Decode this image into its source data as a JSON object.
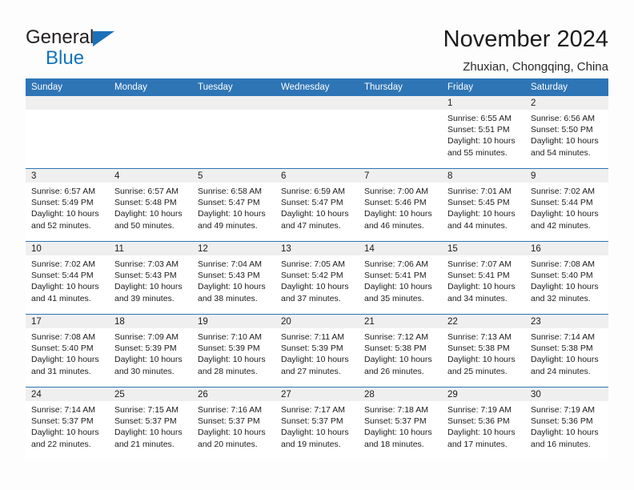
{
  "brand": {
    "name_part1": "General",
    "name_part2": "Blue",
    "logo_icon": "blue-triangle-icon",
    "accent_color": "#1573bb"
  },
  "header": {
    "month_title": "November 2024",
    "location": "Zhuxian, Chongqing, China"
  },
  "theme": {
    "header_blue": "#2e75b6",
    "daynum_band_gray": "#efefef",
    "cell_white": "#ffffff",
    "text_dark": "#1c1c1c"
  },
  "calendar": {
    "weekday_headers": [
      "Sunday",
      "Monday",
      "Tuesday",
      "Wednesday",
      "Thursday",
      "Friday",
      "Saturday"
    ],
    "weeks": [
      [
        {
          "day": "",
          "empty": true,
          "sunrise": "",
          "sunset": "",
          "daylight_line1": "",
          "daylight_line2": ""
        },
        {
          "day": "",
          "empty": true,
          "sunrise": "",
          "sunset": "",
          "daylight_line1": "",
          "daylight_line2": ""
        },
        {
          "day": "",
          "empty": true,
          "sunrise": "",
          "sunset": "",
          "daylight_line1": "",
          "daylight_line2": ""
        },
        {
          "day": "",
          "empty": true,
          "sunrise": "",
          "sunset": "",
          "daylight_line1": "",
          "daylight_line2": ""
        },
        {
          "day": "",
          "empty": true,
          "sunrise": "",
          "sunset": "",
          "daylight_line1": "",
          "daylight_line2": ""
        },
        {
          "day": "1",
          "empty": false,
          "sunrise": "Sunrise: 6:55 AM",
          "sunset": "Sunset: 5:51 PM",
          "daylight_line1": "Daylight: 10 hours",
          "daylight_line2": "and 55 minutes."
        },
        {
          "day": "2",
          "empty": false,
          "sunrise": "Sunrise: 6:56 AM",
          "sunset": "Sunset: 5:50 PM",
          "daylight_line1": "Daylight: 10 hours",
          "daylight_line2": "and 54 minutes."
        }
      ],
      [
        {
          "day": "3",
          "empty": false,
          "sunrise": "Sunrise: 6:57 AM",
          "sunset": "Sunset: 5:49 PM",
          "daylight_line1": "Daylight: 10 hours",
          "daylight_line2": "and 52 minutes."
        },
        {
          "day": "4",
          "empty": false,
          "sunrise": "Sunrise: 6:57 AM",
          "sunset": "Sunset: 5:48 PM",
          "daylight_line1": "Daylight: 10 hours",
          "daylight_line2": "and 50 minutes."
        },
        {
          "day": "5",
          "empty": false,
          "sunrise": "Sunrise: 6:58 AM",
          "sunset": "Sunset: 5:47 PM",
          "daylight_line1": "Daylight: 10 hours",
          "daylight_line2": "and 49 minutes."
        },
        {
          "day": "6",
          "empty": false,
          "sunrise": "Sunrise: 6:59 AM",
          "sunset": "Sunset: 5:47 PM",
          "daylight_line1": "Daylight: 10 hours",
          "daylight_line2": "and 47 minutes."
        },
        {
          "day": "7",
          "empty": false,
          "sunrise": "Sunrise: 7:00 AM",
          "sunset": "Sunset: 5:46 PM",
          "daylight_line1": "Daylight: 10 hours",
          "daylight_line2": "and 46 minutes."
        },
        {
          "day": "8",
          "empty": false,
          "sunrise": "Sunrise: 7:01 AM",
          "sunset": "Sunset: 5:45 PM",
          "daylight_line1": "Daylight: 10 hours",
          "daylight_line2": "and 44 minutes."
        },
        {
          "day": "9",
          "empty": false,
          "sunrise": "Sunrise: 7:02 AM",
          "sunset": "Sunset: 5:44 PM",
          "daylight_line1": "Daylight: 10 hours",
          "daylight_line2": "and 42 minutes."
        }
      ],
      [
        {
          "day": "10",
          "empty": false,
          "sunrise": "Sunrise: 7:02 AM",
          "sunset": "Sunset: 5:44 PM",
          "daylight_line1": "Daylight: 10 hours",
          "daylight_line2": "and 41 minutes."
        },
        {
          "day": "11",
          "empty": false,
          "sunrise": "Sunrise: 7:03 AM",
          "sunset": "Sunset: 5:43 PM",
          "daylight_line1": "Daylight: 10 hours",
          "daylight_line2": "and 39 minutes."
        },
        {
          "day": "12",
          "empty": false,
          "sunrise": "Sunrise: 7:04 AM",
          "sunset": "Sunset: 5:43 PM",
          "daylight_line1": "Daylight: 10 hours",
          "daylight_line2": "and 38 minutes."
        },
        {
          "day": "13",
          "empty": false,
          "sunrise": "Sunrise: 7:05 AM",
          "sunset": "Sunset: 5:42 PM",
          "daylight_line1": "Daylight: 10 hours",
          "daylight_line2": "and 37 minutes."
        },
        {
          "day": "14",
          "empty": false,
          "sunrise": "Sunrise: 7:06 AM",
          "sunset": "Sunset: 5:41 PM",
          "daylight_line1": "Daylight: 10 hours",
          "daylight_line2": "and 35 minutes."
        },
        {
          "day": "15",
          "empty": false,
          "sunrise": "Sunrise: 7:07 AM",
          "sunset": "Sunset: 5:41 PM",
          "daylight_line1": "Daylight: 10 hours",
          "daylight_line2": "and 34 minutes."
        },
        {
          "day": "16",
          "empty": false,
          "sunrise": "Sunrise: 7:08 AM",
          "sunset": "Sunset: 5:40 PM",
          "daylight_line1": "Daylight: 10 hours",
          "daylight_line2": "and 32 minutes."
        }
      ],
      [
        {
          "day": "17",
          "empty": false,
          "sunrise": "Sunrise: 7:08 AM",
          "sunset": "Sunset: 5:40 PM",
          "daylight_line1": "Daylight: 10 hours",
          "daylight_line2": "and 31 minutes."
        },
        {
          "day": "18",
          "empty": false,
          "sunrise": "Sunrise: 7:09 AM",
          "sunset": "Sunset: 5:39 PM",
          "daylight_line1": "Daylight: 10 hours",
          "daylight_line2": "and 30 minutes."
        },
        {
          "day": "19",
          "empty": false,
          "sunrise": "Sunrise: 7:10 AM",
          "sunset": "Sunset: 5:39 PM",
          "daylight_line1": "Daylight: 10 hours",
          "daylight_line2": "and 28 minutes."
        },
        {
          "day": "20",
          "empty": false,
          "sunrise": "Sunrise: 7:11 AM",
          "sunset": "Sunset: 5:39 PM",
          "daylight_line1": "Daylight: 10 hours",
          "daylight_line2": "and 27 minutes."
        },
        {
          "day": "21",
          "empty": false,
          "sunrise": "Sunrise: 7:12 AM",
          "sunset": "Sunset: 5:38 PM",
          "daylight_line1": "Daylight: 10 hours",
          "daylight_line2": "and 26 minutes."
        },
        {
          "day": "22",
          "empty": false,
          "sunrise": "Sunrise: 7:13 AM",
          "sunset": "Sunset: 5:38 PM",
          "daylight_line1": "Daylight: 10 hours",
          "daylight_line2": "and 25 minutes."
        },
        {
          "day": "23",
          "empty": false,
          "sunrise": "Sunrise: 7:14 AM",
          "sunset": "Sunset: 5:38 PM",
          "daylight_line1": "Daylight: 10 hours",
          "daylight_line2": "and 24 minutes."
        }
      ],
      [
        {
          "day": "24",
          "empty": false,
          "sunrise": "Sunrise: 7:14 AM",
          "sunset": "Sunset: 5:37 PM",
          "daylight_line1": "Daylight: 10 hours",
          "daylight_line2": "and 22 minutes."
        },
        {
          "day": "25",
          "empty": false,
          "sunrise": "Sunrise: 7:15 AM",
          "sunset": "Sunset: 5:37 PM",
          "daylight_line1": "Daylight: 10 hours",
          "daylight_line2": "and 21 minutes."
        },
        {
          "day": "26",
          "empty": false,
          "sunrise": "Sunrise: 7:16 AM",
          "sunset": "Sunset: 5:37 PM",
          "daylight_line1": "Daylight: 10 hours",
          "daylight_line2": "and 20 minutes."
        },
        {
          "day": "27",
          "empty": false,
          "sunrise": "Sunrise: 7:17 AM",
          "sunset": "Sunset: 5:37 PM",
          "daylight_line1": "Daylight: 10 hours",
          "daylight_line2": "and 19 minutes."
        },
        {
          "day": "28",
          "empty": false,
          "sunrise": "Sunrise: 7:18 AM",
          "sunset": "Sunset: 5:37 PM",
          "daylight_line1": "Daylight: 10 hours",
          "daylight_line2": "and 18 minutes."
        },
        {
          "day": "29",
          "empty": false,
          "sunrise": "Sunrise: 7:19 AM",
          "sunset": "Sunset: 5:36 PM",
          "daylight_line1": "Daylight: 10 hours",
          "daylight_line2": "and 17 minutes."
        },
        {
          "day": "30",
          "empty": false,
          "sunrise": "Sunrise: 7:19 AM",
          "sunset": "Sunset: 5:36 PM",
          "daylight_line1": "Daylight: 10 hours",
          "daylight_line2": "and 16 minutes."
        }
      ]
    ]
  }
}
